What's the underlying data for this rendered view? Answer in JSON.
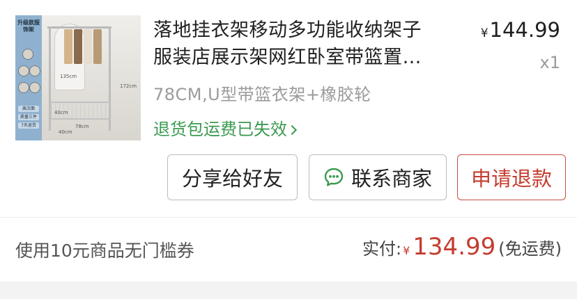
{
  "product": {
    "thumbnail": {
      "side_tag": "升级款服饰架",
      "side_buttons": [
        "高次面",
        "质量三件",
        "7天退货"
      ],
      "dims": [
        "135cm",
        "172cm",
        "40cm",
        "78cm",
        "40cm"
      ]
    },
    "title_line1": "落地挂衣架移动多功能收纳架子",
    "title_line2": "服装店展示架网红卧室带篮置…",
    "price_symbol": "¥",
    "price": "144.99",
    "quantity": "x1",
    "spec": "78CM,U型带篮衣架+橡胶轮",
    "return_note": "退货包运费已失效",
    "return_note_chevron": "chevron-right-icon"
  },
  "actions": {
    "share_label": "分享给好友",
    "contact_label": "联系商家",
    "contact_icon": "chat-bubble-icon",
    "refund_label": "申请退款"
  },
  "summary": {
    "coupon_text": "使用10元商品无门槛券",
    "paid_label": "实付:",
    "paid_symbol": "¥",
    "paid_amount": "134.99",
    "shipping_note": "(免运费)"
  },
  "colors": {
    "accent_red": "#c43c2f",
    "return_green": "#3a9a4f",
    "chat_green": "#3a9a4f"
  }
}
